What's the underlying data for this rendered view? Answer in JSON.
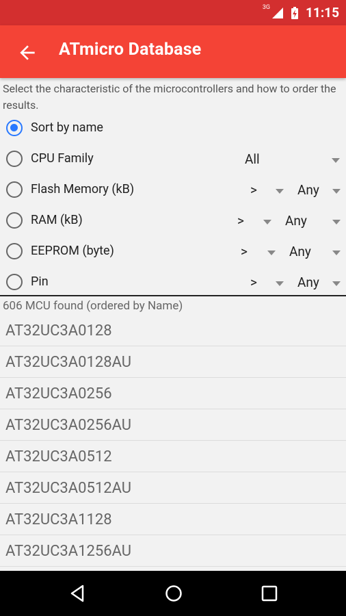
{
  "status_bar": {
    "network": "3G",
    "time": "11:15"
  },
  "app_bar": {
    "title": "ATmicro Database",
    "back_icon": "arrow-back-icon"
  },
  "instructions": "Select the characteristic of the microcontrollers and how to order the results.",
  "filters": [
    {
      "label": "Sort by name",
      "checked": true
    },
    {
      "label": "CPU Family",
      "checked": false,
      "value": "All"
    },
    {
      "label": "Flash Memory (kB)",
      "checked": false,
      "operator": ">",
      "value": "Any"
    },
    {
      "label": "RAM (kB)",
      "checked": false,
      "operator": ">",
      "value": "Any"
    },
    {
      "label": "EEPROM (byte)",
      "checked": false,
      "operator": ">",
      "value": "Any"
    },
    {
      "label": "Pin",
      "checked": false,
      "operator": ">",
      "value": "Any"
    }
  ],
  "result_count": "606 MCU found (ordered by Name)",
  "results": [
    "AT32UC3A0128",
    "AT32UC3A0128AU",
    "AT32UC3A0256",
    "AT32UC3A0256AU",
    "AT32UC3A0512",
    "AT32UC3A0512AU",
    "AT32UC3A1128",
    "AT32UC3A1256AU"
  ],
  "colors": {
    "status_bar": "#d32f2f",
    "app_bar": "#f44336",
    "radio_accent": "#2979ff"
  },
  "nav_bar": {
    "back": "nav-back-icon",
    "home": "nav-home-icon",
    "recents": "nav-recents-icon"
  }
}
